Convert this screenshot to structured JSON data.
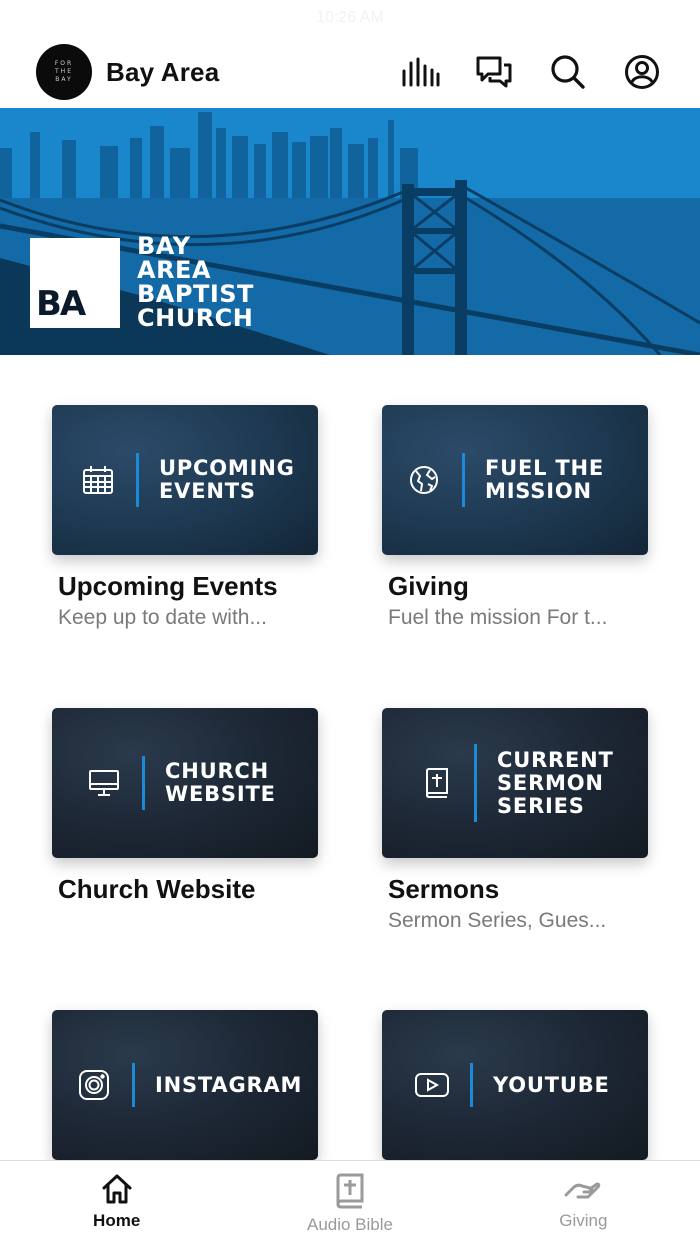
{
  "status_bar": {
    "time": "10:26 AM"
  },
  "header": {
    "logo_text": "FOR THE BAY",
    "title": "Bay Area",
    "icons": [
      "audio-bars-icon",
      "chat-icon",
      "search-icon",
      "account-icon"
    ]
  },
  "hero": {
    "logo_letters": "BA",
    "name_lines": [
      "BAY",
      "AREA",
      "BAPTIST",
      "CHURCH"
    ]
  },
  "cards": [
    {
      "thumb_lines": [
        "UPCOMING",
        "EVENTS"
      ],
      "icon": "calendar-icon",
      "title": "Upcoming Events",
      "subtitle": "Keep up to date with..."
    },
    {
      "thumb_lines": [
        "FUEL THE",
        "MISSION"
      ],
      "icon": "globe-icon",
      "title": "Giving",
      "subtitle": "Fuel the mission For t..."
    },
    {
      "thumb_lines": [
        "CHURCH",
        "WEBSITE"
      ],
      "icon": "monitor-icon",
      "title": "Church Website",
      "subtitle": ""
    },
    {
      "thumb_lines": [
        "CURRENT",
        "SERMON",
        "SERIES"
      ],
      "icon": "bible-icon",
      "title": "Sermons",
      "subtitle": "Sermon Series, Gues..."
    },
    {
      "thumb_lines": [
        "INSTAGRAM"
      ],
      "icon": "instagram-icon",
      "title": "",
      "subtitle": ""
    },
    {
      "thumb_lines": [
        "YOUTUBE"
      ],
      "icon": "youtube-icon",
      "title": "",
      "subtitle": ""
    }
  ],
  "tabs": [
    {
      "label": "Home",
      "icon": "home-icon",
      "active": true
    },
    {
      "label": "Audio Bible",
      "icon": "bible-icon",
      "active": false
    },
    {
      "label": "Giving",
      "icon": "giving-hand-icon",
      "active": false
    }
  ],
  "colors": {
    "accent_bar": "#1c8ad6",
    "hero_blue": "#1a86cc",
    "card_dark": "#1c2633"
  }
}
